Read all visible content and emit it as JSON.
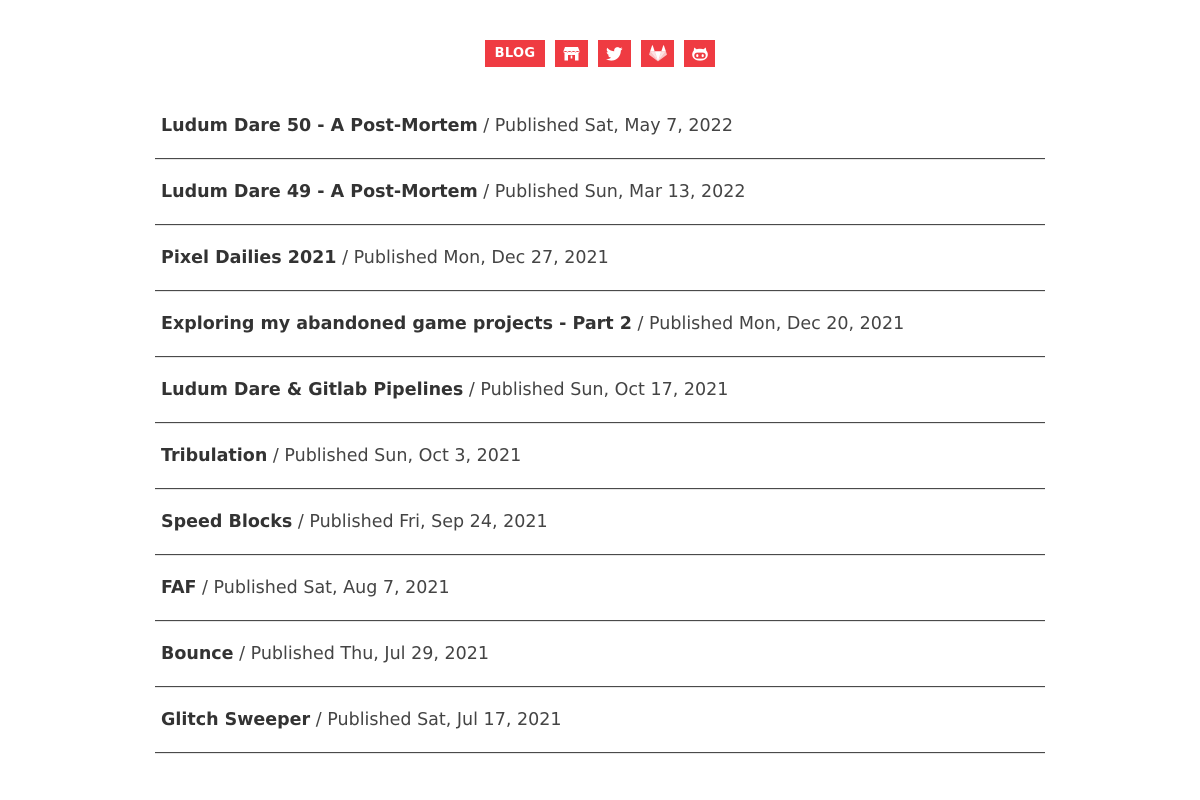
{
  "nav": {
    "blog_label": "BLOG",
    "icons": [
      "itchio-icon",
      "twitter-icon",
      "gitlab-icon",
      "github-icon"
    ],
    "accent_color": "#ef3b42"
  },
  "posts": [
    {
      "title": "Ludum Dare 50 - A Post-Mortem",
      "date": "Published Sat, May 7, 2022"
    },
    {
      "title": "Ludum Dare 49 - A Post-Mortem",
      "date": "Published Sun, Mar 13, 2022"
    },
    {
      "title": "Pixel Dailies 2021",
      "date": "Published Mon, Dec 27, 2021"
    },
    {
      "title": "Exploring my abandoned game projects - Part 2",
      "date": "Published Mon, Dec 20, 2021"
    },
    {
      "title": "Ludum Dare & Gitlab Pipelines",
      "date": "Published Sun, Oct 17, 2021"
    },
    {
      "title": "Tribulation",
      "date": "Published Sun, Oct 3, 2021"
    },
    {
      "title": "Speed Blocks",
      "date": "Published Fri, Sep 24, 2021"
    },
    {
      "title": "FAF",
      "date": "Published Sat, Aug 7, 2021"
    },
    {
      "title": "Bounce",
      "date": "Published Thu, Jul 29, 2021"
    },
    {
      "title": "Glitch Sweeper",
      "date": "Published Sat, Jul 17, 2021"
    }
  ],
  "separator": "/"
}
